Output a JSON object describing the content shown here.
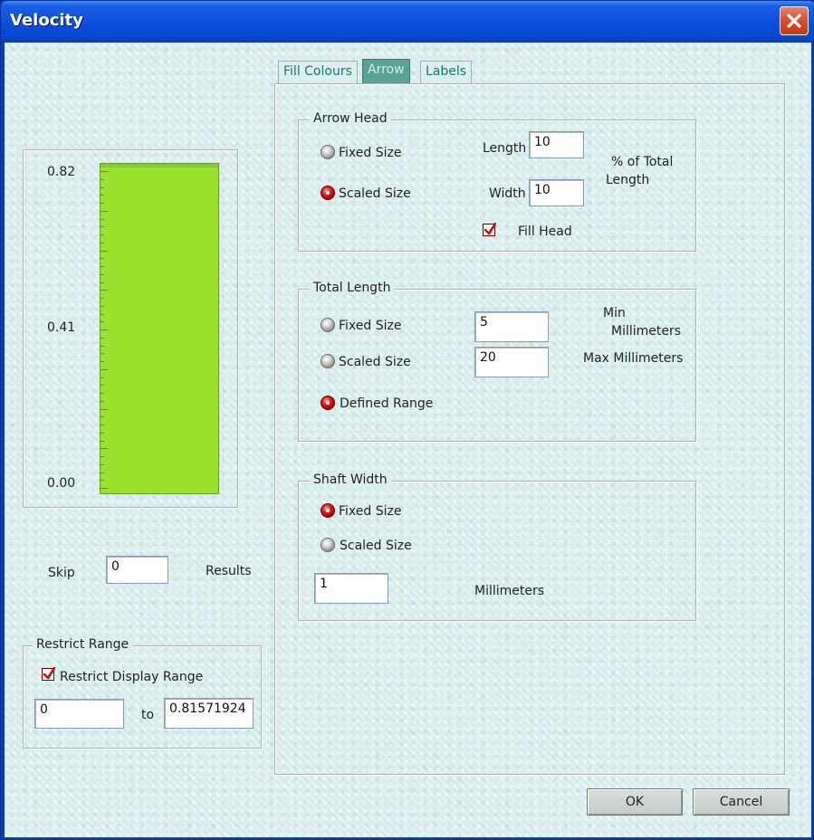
{
  "window": {
    "title": "Velocity"
  },
  "legend": {
    "labels": [
      "0.82",
      "0.41",
      "0.00"
    ],
    "bar_color": "#9ae22e"
  },
  "skip": {
    "label": "Skip",
    "value": "0",
    "suffix": "Results"
  },
  "restrict": {
    "group_label": "Restrict Range",
    "checkbox_label": "Restrict Display Range",
    "checked": true,
    "from_value": "0",
    "to_label": "to",
    "to_value": "0.81571924"
  },
  "tabs": [
    {
      "label": "Fill Colours",
      "active": false
    },
    {
      "label": "Arrow",
      "active": true
    },
    {
      "label": "Labels",
      "active": false
    }
  ],
  "arrow_head": {
    "group_label": "Arrow Head",
    "fixed_size_label": "Fixed Size",
    "scaled_size_label": "Scaled Size",
    "selected": "Scaled Size",
    "length_label": "Length",
    "length_value": "10",
    "width_label": "Width",
    "width_value": "10",
    "pct_label_line1": "% of Total",
    "pct_label_line2": "Length",
    "fill_head_label": "Fill Head",
    "fill_head_checked": true
  },
  "total_length": {
    "group_label": "Total Length",
    "fixed_size_label": "Fixed Size",
    "scaled_size_label": "Scaled Size",
    "defined_range_label": "Defined Range",
    "selected": "Defined Range",
    "min_value": "5",
    "max_value": "20",
    "min_label_line1": "Min",
    "min_label_line2": "Millimeters",
    "max_label": "Max Millimeters"
  },
  "shaft_width": {
    "group_label": "Shaft Width",
    "fixed_size_label": "Fixed Size",
    "scaled_size_label": "Scaled Size",
    "selected": "Fixed Size",
    "value": "1",
    "unit_label": "Millimeters"
  },
  "buttons": {
    "ok": "OK",
    "cancel": "Cancel"
  }
}
